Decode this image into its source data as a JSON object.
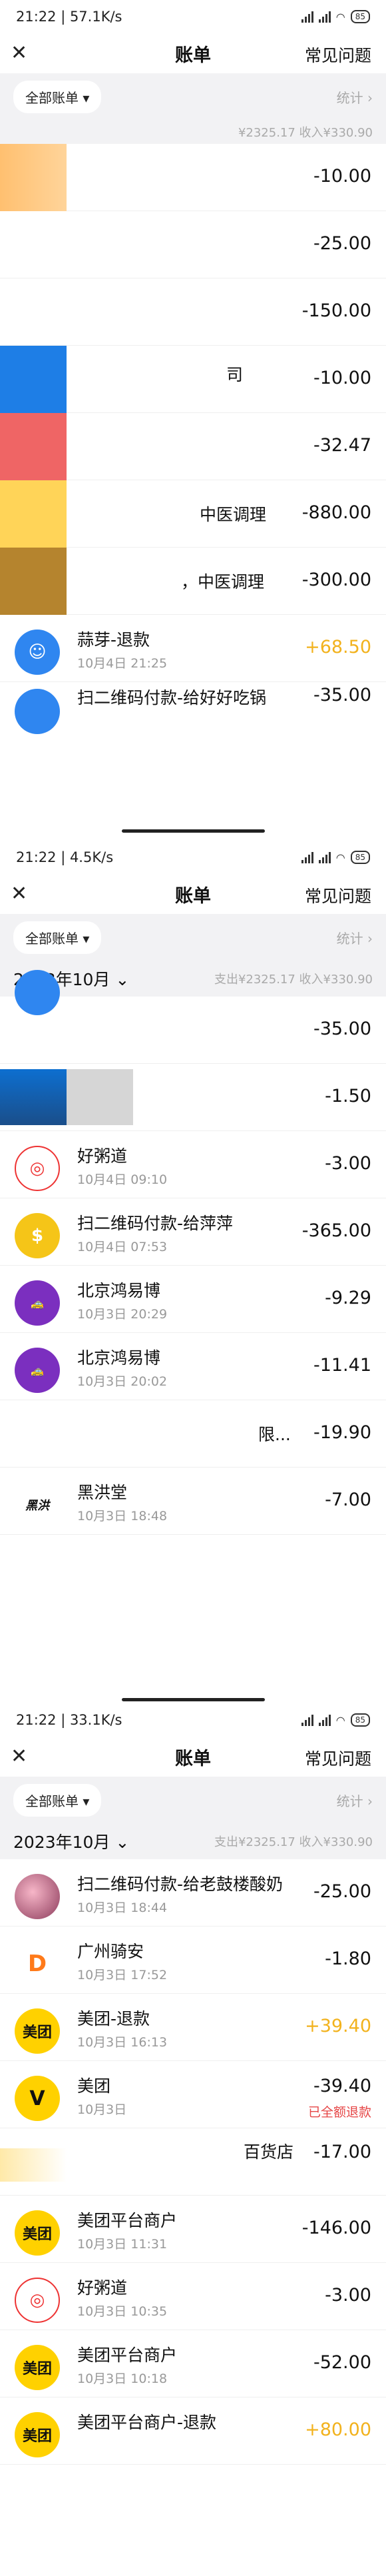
{
  "app": {
    "nav_title": "账单",
    "faq": "常见问题",
    "filter_label": "全部账单",
    "stat_label": "统计"
  },
  "colors": {
    "income": "#f2b21d",
    "refund_note": "#e64646",
    "meituan_yellow": "#ffd100",
    "alipay_blue": "#1677ff"
  },
  "shots": [
    {
      "status_time": "21:22 | 57.1K/s",
      "battery": "85",
      "summary": "¥2325.17  收入¥330.90",
      "rows": [
        {
          "icon": "blurred-icon",
          "title": "",
          "time": "",
          "amount": "-10.00"
        },
        {
          "icon": "blurred-icon",
          "title": "",
          "time": "",
          "amount": "-25.00"
        },
        {
          "icon": "blurred-icon",
          "title": "",
          "time": "",
          "amount": "-150.00"
        },
        {
          "icon": "blurred-icon",
          "title": "司",
          "time": "",
          "amount": "-10.00"
        },
        {
          "icon": "blurred-icon",
          "title": "",
          "time": "",
          "amount": "-32.47"
        },
        {
          "icon": "blurred-icon",
          "title": "中医调理",
          "time": "",
          "amount": "-880.00"
        },
        {
          "icon": "blurred-icon",
          "title": "，中医调理",
          "time": "",
          "amount": "-300.00"
        },
        {
          "icon": "refund-icon",
          "title": "蒜芽-退款",
          "time": "10月4日 21:25",
          "amount": "+68.50"
        },
        {
          "icon": "partial-icon",
          "title": "扫二维码付款-给好好吃锅",
          "time": "",
          "amount": "-35.00"
        }
      ]
    },
    {
      "status_time": "21:22 | 4.5K/s",
      "battery": "85",
      "month": "2023年10月",
      "summary": "支出¥2325.17  收入¥330.90",
      "rows": [
        {
          "icon": "blurred-icon",
          "title": "",
          "time": "",
          "amount": "-35.00"
        },
        {
          "icon": "blurred-icon",
          "title": "",
          "time": "",
          "amount": "-1.50"
        },
        {
          "icon": "porridge-icon",
          "title": "好粥道",
          "time": "10月4日 09:10",
          "amount": "-3.00"
        },
        {
          "icon": "money-bag-icon",
          "title": "扫二维码付款-给萍萍",
          "time": "10月4日 07:53",
          "amount": "-365.00"
        },
        {
          "icon": "taxi-icon",
          "title": "北京鸿易博",
          "time": "10月3日 20:29",
          "amount": "-9.29"
        },
        {
          "icon": "taxi-icon",
          "title": "北京鸿易博",
          "time": "10月3日 20:02",
          "amount": "-11.41"
        },
        {
          "icon": "blurred-icon",
          "title": "限...",
          "time": "",
          "amount": "-19.90"
        },
        {
          "icon": "hongtang-logo-icon",
          "title": "黑洪堂",
          "time": "10月3日 18:48",
          "amount": "-7.00"
        }
      ]
    },
    {
      "status_time": "21:22 | 33.1K/s",
      "battery": "85",
      "month": "2023年10月",
      "summary": "支出¥2325.17  收入¥330.90",
      "rows": [
        {
          "icon": "fruit-icon",
          "title": "扫二维码付款-给老鼓楼酸奶",
          "time": "10月3日 18:44",
          "amount": "-25.00"
        },
        {
          "icon": "didi-icon",
          "title": "广州骑安",
          "time": "10月3日 17:52",
          "amount": "-1.80"
        },
        {
          "icon": "meituan-icon",
          "icon_text": "美团",
          "title": "美团-退款",
          "time": "10月3日 16:13",
          "amount": "+39.40"
        },
        {
          "icon": "meituan-rabbit-icon",
          "title": "美团",
          "time": "10月3日",
          "amount": "-39.40",
          "note": "已全额退款"
        },
        {
          "icon": "blurred-icon",
          "title": "百货店",
          "time": "",
          "amount": "-17.00"
        },
        {
          "icon": "meituan-icon",
          "icon_text": "美团",
          "title": "美团平台商户",
          "time": "10月3日 11:31",
          "amount": "-146.00"
        },
        {
          "icon": "porridge-icon",
          "title": "好粥道",
          "time": "10月3日 10:35",
          "amount": "-3.00"
        },
        {
          "icon": "meituan-icon",
          "icon_text": "美团",
          "title": "美团平台商户",
          "time": "10月3日 10:18",
          "amount": "-52.00"
        },
        {
          "icon": "meituan-icon",
          "icon_text": "美团",
          "title": "美团平台商户-退款",
          "time": "",
          "amount": "+80.00"
        }
      ]
    }
  ]
}
